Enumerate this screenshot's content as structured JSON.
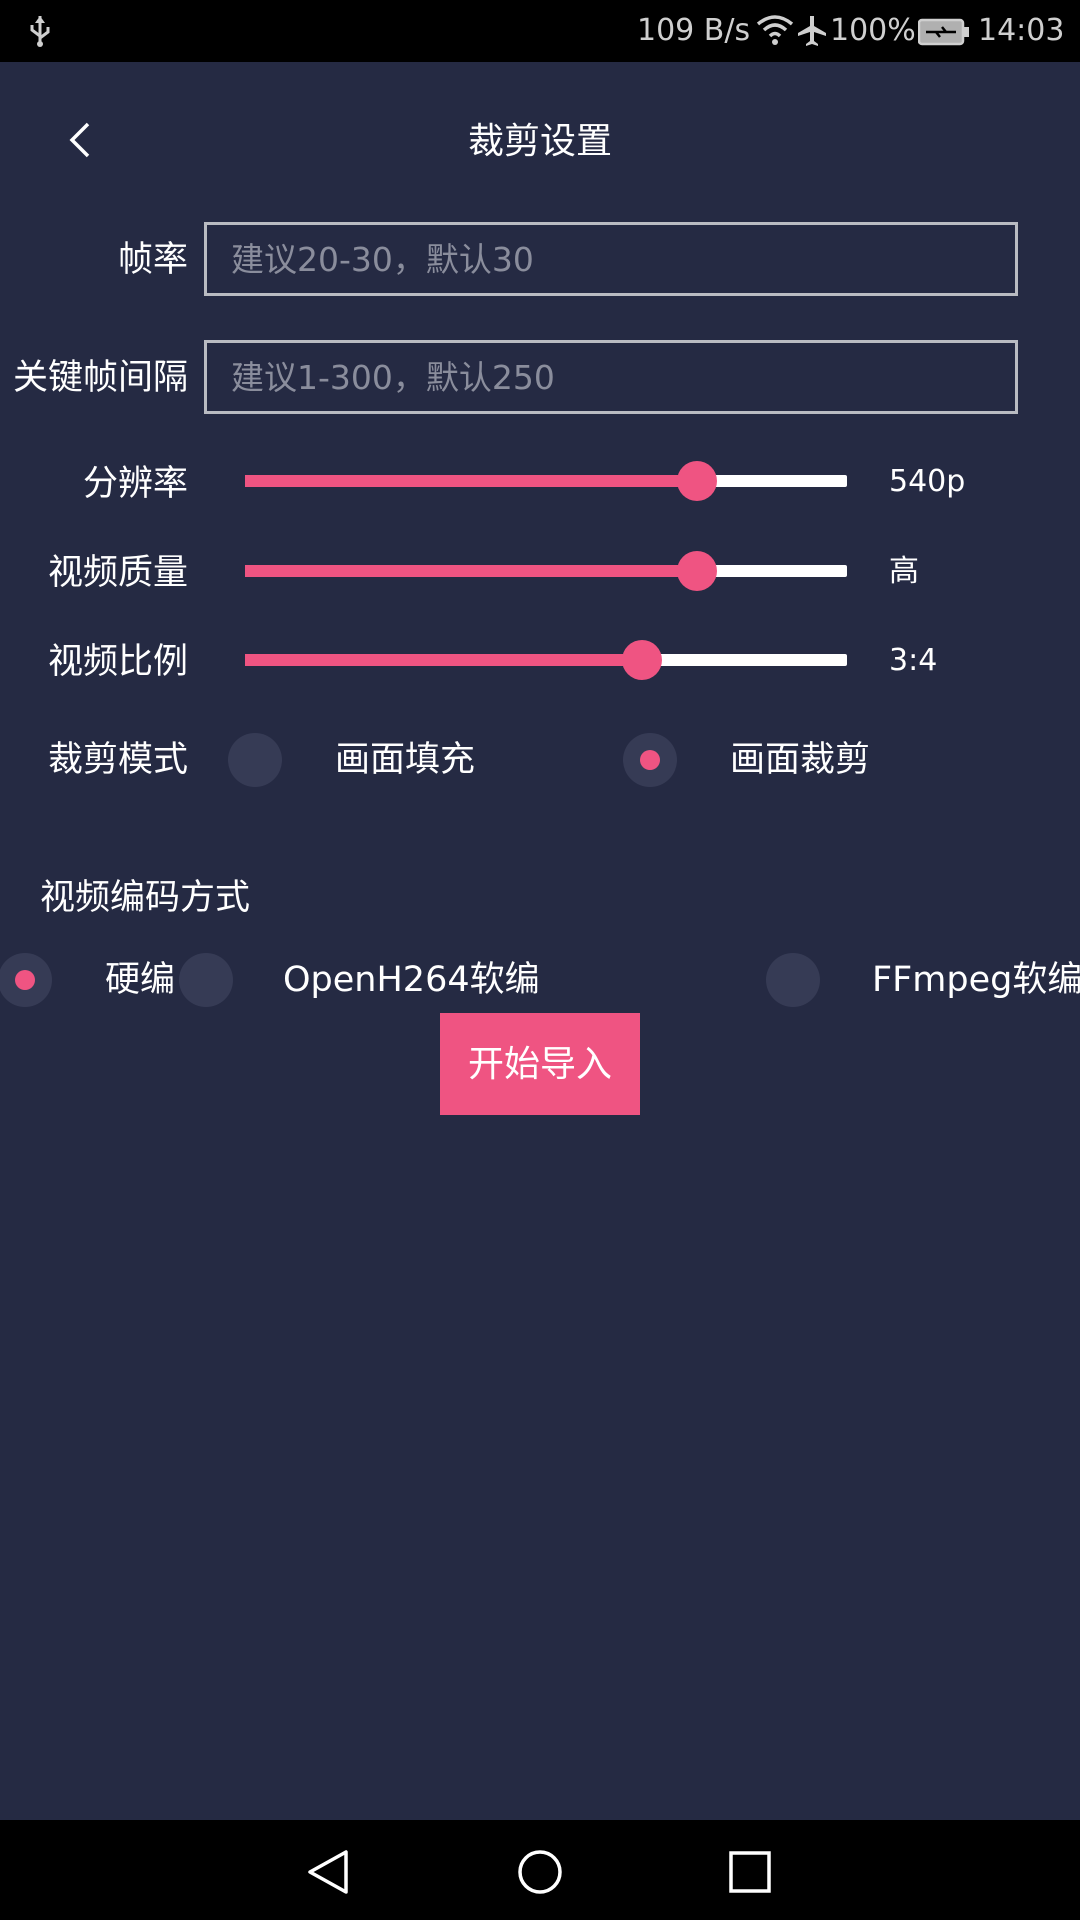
{
  "status_bar": {
    "net_speed": "109 B/s",
    "battery": "100%",
    "time": "14:03",
    "icons": [
      "usb-icon",
      "wifi-icon",
      "airplane-icon",
      "battery-charging-icon"
    ]
  },
  "header": {
    "title": "裁剪设置",
    "back_icon": "chevron-left-icon"
  },
  "form": {
    "frame_rate": {
      "label": "帧率",
      "value": "",
      "placeholder": "建议20-30，默认30"
    },
    "keyframe_interval": {
      "label": "关键帧间隔",
      "value": "",
      "placeholder": "建议1-300，默认250"
    },
    "resolution": {
      "label": "分辨率",
      "value": "540p",
      "level": 0.75
    },
    "video_quality": {
      "label": "视频质量",
      "value": "高",
      "level": 0.75
    },
    "aspect_ratio": {
      "label": "视频比例",
      "value": "3:4",
      "level": 0.66
    },
    "crop_mode": {
      "label": "裁剪模式",
      "options": [
        {
          "label": "画面填充",
          "selected": false
        },
        {
          "label": "画面裁剪",
          "selected": true
        }
      ]
    },
    "encoding": {
      "label": "视频编码方式",
      "options": [
        {
          "label": "硬编",
          "selected": true
        },
        {
          "label": "OpenH264软编",
          "selected": false
        },
        {
          "label": "FFmpeg软编",
          "selected": false
        }
      ]
    }
  },
  "actions": {
    "start_label": "开始导入"
  },
  "nav_bar": {
    "icons": [
      "nav-back-icon",
      "nav-home-icon",
      "nav-recents-icon"
    ]
  },
  "colors": {
    "background": "#252a43",
    "accent": "#ef5482",
    "track": "#ffffff",
    "radio_bg": "#363b55"
  }
}
